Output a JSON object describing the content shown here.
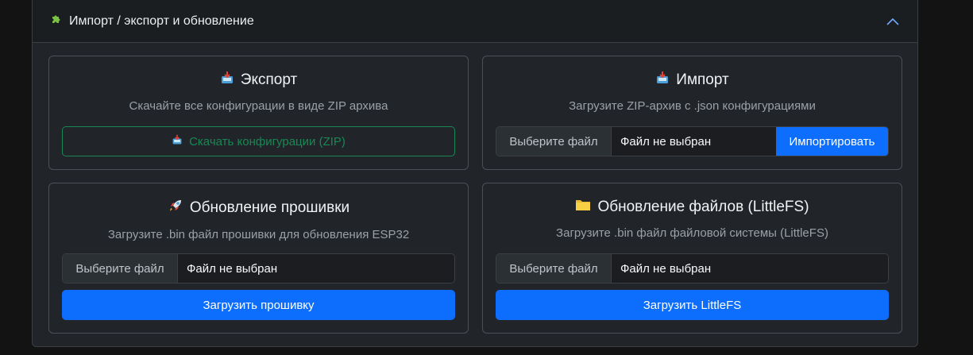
{
  "header": {
    "title": "Импорт / экспорт и обновление",
    "icon": "puzzle-icon"
  },
  "export": {
    "title": "Экспорт",
    "subtitle": "Скачайте все конфигурации в виде ZIP архива",
    "button_label": "Скачать конфигурации (ZIP)",
    "icon": "inbox-tray-icon"
  },
  "import": {
    "title": "Импорт",
    "subtitle": "Загрузите ZIP-архив с .json конфигурациями",
    "file_button": "Выберите файл",
    "file_name": "Файл не выбран",
    "action_label": "Импортировать",
    "icon": "inbox-tray-icon"
  },
  "firmware": {
    "title": "Обновление прошивки",
    "subtitle": "Загрузите .bin файл прошивки для обновления ESP32",
    "file_button": "Выберите файл",
    "file_name": "Файл не выбран",
    "button_label": "Загрузить прошивку",
    "icon": "rocket-icon"
  },
  "littlefs": {
    "title": "Обновление файлов (LittleFS)",
    "subtitle": "Загрузите .bin файл файловой системы (LittleFS)",
    "file_button": "Выберите файл",
    "file_name": "Файл не выбран",
    "button_label": "Загрузить LittleFS",
    "icon": "folder-icon"
  },
  "colors": {
    "primary": "#0d6efd",
    "success": "#198754",
    "background": "#212529"
  }
}
